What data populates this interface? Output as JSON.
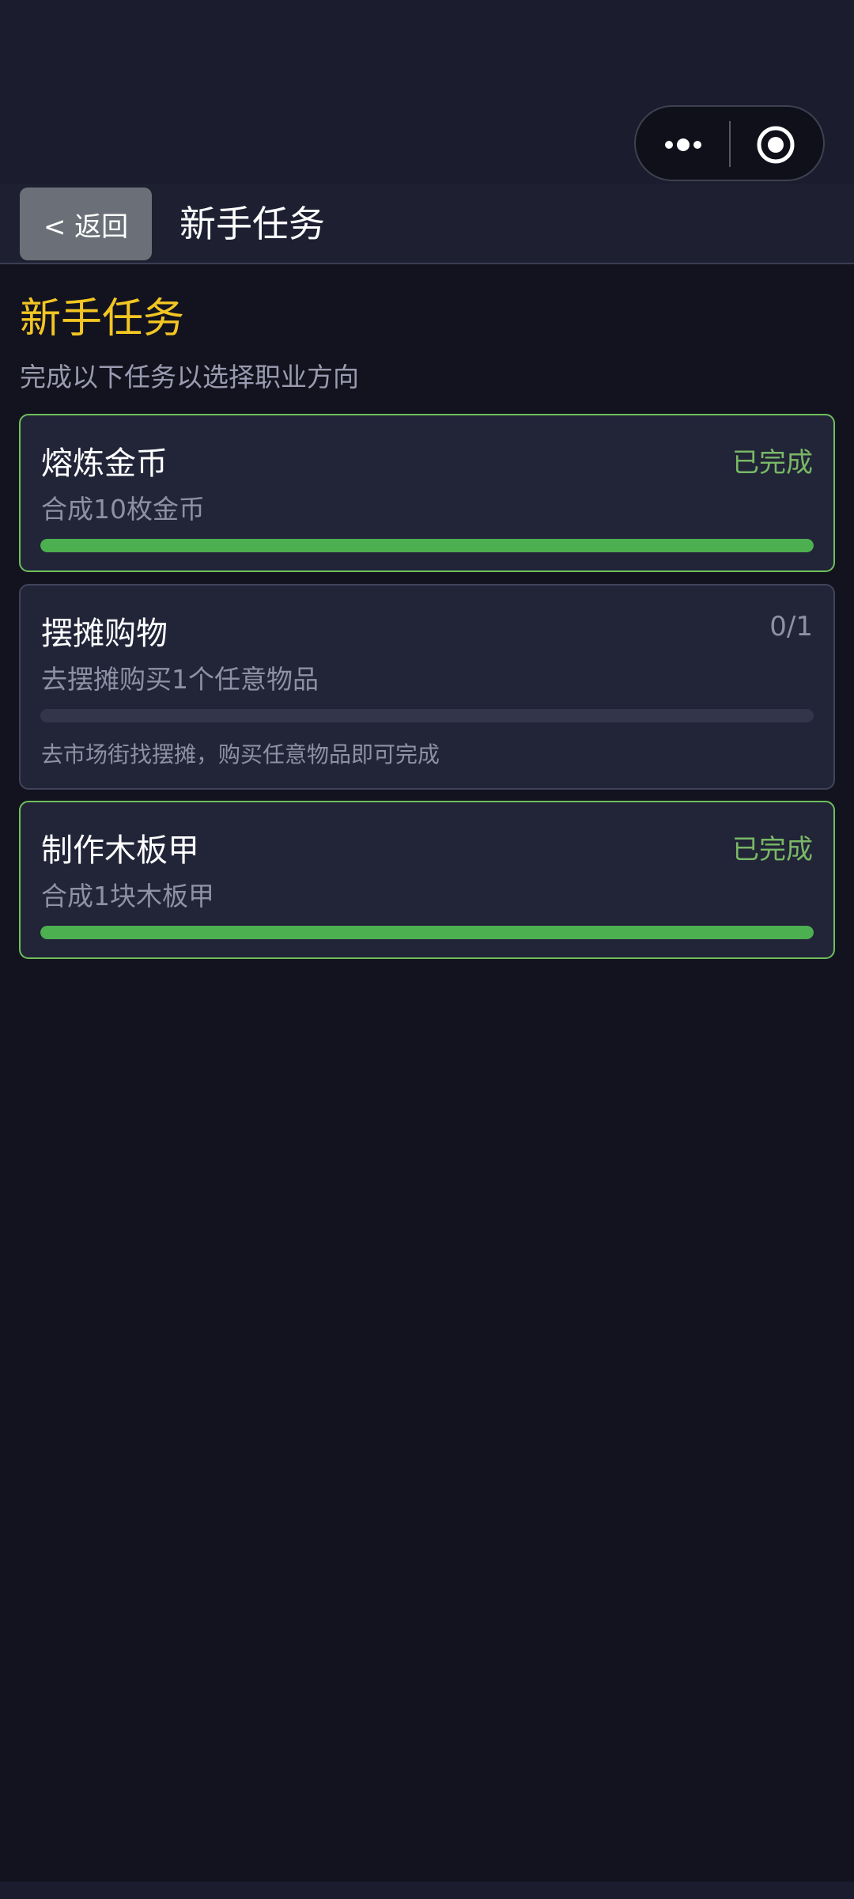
{
  "nav": {
    "back_label": "< 返回",
    "title": "新手任务"
  },
  "page": {
    "heading": "新手任务",
    "subheading": "完成以下任务以选择职业方向"
  },
  "tasks": [
    {
      "name": "熔炼金币",
      "status": "已完成",
      "description": "合成10枚金币",
      "progress": 1.0,
      "completed": true
    },
    {
      "name": "摆摊购物",
      "status": "0/1",
      "description": "去摆摊购买1个任意物品",
      "progress": 0.0,
      "hint": "去市场街找摆摊，购买任意物品即可完成",
      "completed": false
    },
    {
      "name": "制作木板甲",
      "status": "已完成",
      "description": "合成1块木板甲",
      "progress": 1.0,
      "completed": true
    }
  ],
  "colors": {
    "accent_heading": "#f3c623",
    "completed_green": "#4caf50",
    "completed_text": "#79b866"
  },
  "icons": {
    "capsule_more": "more-dots-icon",
    "capsule_close": "target-circle-icon"
  }
}
